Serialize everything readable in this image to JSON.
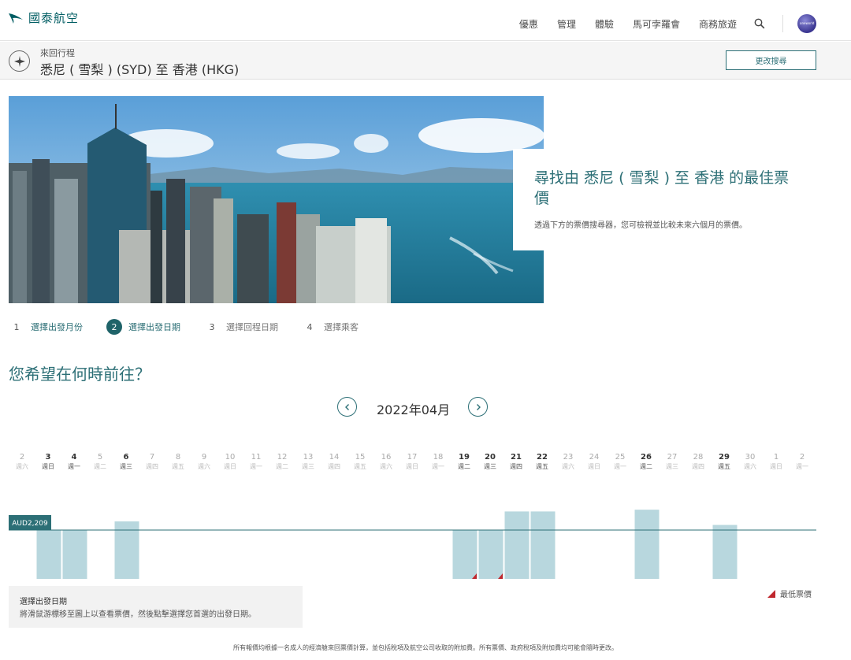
{
  "header": {
    "logo_text": "國泰航空",
    "nav": [
      "優惠",
      "管理",
      "體驗",
      "馬可孛羅會",
      "商務旅遊"
    ],
    "avatar_text": "oneworld"
  },
  "trip": {
    "subtitle": "來回行程",
    "title": "悉尼 ( 雪梨 )  (SYD) 至 香港 (HKG)",
    "edit_button": "更改搜尋"
  },
  "hero": {
    "title": "尋找由 悉尼 ( 雪梨 ) 至 香港 的最佳票價",
    "description": "透過下方的票價搜尋器，您可檢視並比較未來六個月的票價。"
  },
  "steps": [
    {
      "num": "1",
      "label": "選擇出發月份",
      "state": "done"
    },
    {
      "num": "2",
      "label": "選擇出發日期",
      "state": "active"
    },
    {
      "num": "3",
      "label": "選擇回程日期",
      "state": "pending"
    },
    {
      "num": "4",
      "label": "選擇乘客",
      "state": "pending"
    }
  ],
  "question": "您希望在何時前往？",
  "month": "2022年04月",
  "chart_data": {
    "type": "bar",
    "reference_label": "AUD2,209",
    "reference_value": 2209,
    "days": [
      {
        "d": "2",
        "w": "週六",
        "v": null,
        "bold": false
      },
      {
        "d": "3",
        "w": "週日",
        "v": 2209,
        "bold": true
      },
      {
        "d": "4",
        "w": "週一",
        "v": 2209,
        "bold": true
      },
      {
        "d": "5",
        "w": "週二",
        "v": null,
        "bold": false
      },
      {
        "d": "6",
        "w": "週三",
        "v": 2600,
        "bold": true
      },
      {
        "d": "7",
        "w": "週四",
        "v": null,
        "bold": false
      },
      {
        "d": "8",
        "w": "週五",
        "v": null,
        "bold": false
      },
      {
        "d": "9",
        "w": "週六",
        "v": null,
        "bold": false
      },
      {
        "d": "10",
        "w": "週日",
        "v": null,
        "bold": false
      },
      {
        "d": "11",
        "w": "週一",
        "v": null,
        "bold": false
      },
      {
        "d": "12",
        "w": "週二",
        "v": null,
        "bold": false
      },
      {
        "d": "13",
        "w": "週三",
        "v": null,
        "bold": false
      },
      {
        "d": "14",
        "w": "週四",
        "v": null,
        "bold": false
      },
      {
        "d": "15",
        "w": "週五",
        "v": null,
        "bold": false
      },
      {
        "d": "16",
        "w": "週六",
        "v": null,
        "bold": false
      },
      {
        "d": "17",
        "w": "週日",
        "v": null,
        "bold": false
      },
      {
        "d": "18",
        "w": "週一",
        "v": null,
        "bold": false
      },
      {
        "d": "19",
        "w": "週二",
        "v": 2209,
        "bold": true,
        "lowest": true
      },
      {
        "d": "20",
        "w": "週三",
        "v": 2209,
        "bold": true,
        "lowest": true
      },
      {
        "d": "21",
        "w": "週四",
        "v": 3050,
        "bold": true
      },
      {
        "d": "22",
        "w": "週五",
        "v": 3050,
        "bold": true
      },
      {
        "d": "23",
        "w": "週六",
        "v": null,
        "bold": false
      },
      {
        "d": "24",
        "w": "週日",
        "v": null,
        "bold": false
      },
      {
        "d": "25",
        "w": "週一",
        "v": null,
        "bold": false
      },
      {
        "d": "26",
        "w": "週二",
        "v": 3130,
        "bold": true
      },
      {
        "d": "27",
        "w": "週三",
        "v": null,
        "bold": false
      },
      {
        "d": "28",
        "w": "週四",
        "v": null,
        "bold": false
      },
      {
        "d": "29",
        "w": "週五",
        "v": 2440,
        "bold": true
      },
      {
        "d": "30",
        "w": "週六",
        "v": null,
        "bold": false
      },
      {
        "d": "1",
        "w": "週日",
        "v": null,
        "bold": false
      },
      {
        "d": "2",
        "w": "週一",
        "v": null,
        "bold": false
      }
    ]
  },
  "tooltip": {
    "title": "選擇出發日期",
    "text": "將滑鼠游標移至圖上以查看票價，然後點擊選擇您首選的出發日期。"
  },
  "legend_label": "最低票價",
  "footer_note": "所有報價均根據一名成人的經濟艙來回票價計算，並包括稅項及航空公司收取的附加費。所有票價、政府稅項及附加費均可能會隨時更改。",
  "colors": {
    "accent": "#2c6f76",
    "bar": "#b8d7de",
    "lowest_marker": "#c0272d"
  }
}
